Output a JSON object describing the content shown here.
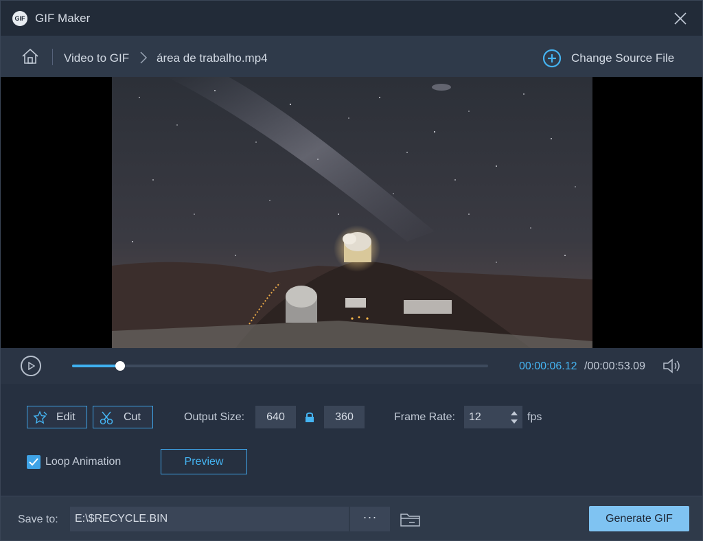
{
  "app": {
    "logo_text": "GIF",
    "title": "GIF Maker"
  },
  "breadcrumb": {
    "items": [
      "Video to GIF",
      "área de trabalho.mp4"
    ],
    "change_source_label": "Change Source File"
  },
  "player": {
    "current_time": "00:00:06.12",
    "total_time": "/00:00:53.09",
    "progress": 0.1153
  },
  "settings": {
    "edit_label": "Edit",
    "cut_label": "Cut",
    "output_size_label": "Output Size:",
    "width": "640",
    "height": "360",
    "frame_rate_label": "Frame Rate:",
    "frame_rate": "12",
    "fps_unit": "fps",
    "loop_label": "Loop Animation",
    "loop_checked": true,
    "preview_label": "Preview"
  },
  "footer": {
    "save_to_label": "Save to:",
    "save_path": "E:\\$RECYCLE.BIN",
    "more_label": "···",
    "generate_label": "Generate GIF"
  },
  "colors": {
    "accent": "#3fa3e6",
    "time_highlight": "#45b4f2",
    "generate_button": "#7fc3f2"
  },
  "icons": [
    "gif-logo-icon",
    "close-icon",
    "home-icon",
    "chevron-right-icon",
    "plus-circle-icon",
    "play-icon",
    "volume-icon",
    "star-edit-icon",
    "scissors-icon",
    "lock-icon",
    "spinner-arrows-icon",
    "checkmark-icon",
    "folder-icon"
  ]
}
